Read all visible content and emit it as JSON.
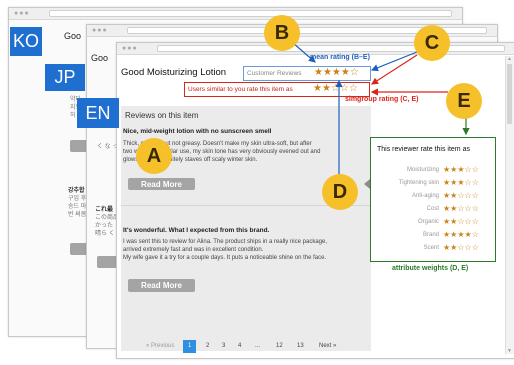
{
  "windows": {
    "ko": {
      "lang": "KO",
      "title": "Goo",
      "side_lines": [
        "약다",
        "지도",
        "허"
      ],
      "side2_lines": [
        "강추합",
        "구입 후",
        "송드 마",
        "번 써봄"
      ]
    },
    "jp": {
      "lang": "JP",
      "title": "Goo",
      "side_lines": [
        "く な っ"
      ],
      "side2_lines": [
        "これ最",
        "この商品",
        "かった",
        "晴ら く"
      ]
    },
    "en": {
      "lang": "EN"
    }
  },
  "main": {
    "product_title": "Good Moisturizing Lotion",
    "customer_reviews_label": "Customer Reviews",
    "customer_reviews_stars": "★★★★☆",
    "similar_users_label": "Users similar to you rate this item as",
    "similar_users_stars": "★★☆☆☆",
    "reviews_heading": "Reviews on this item",
    "reviews": [
      {
        "title": "Nice, mid-weight lotion with no sunscreen smell",
        "body": [
          "Thick, creamy but not greasy. Doesn't make my skin ultra-soft, but after",
          "two weeks of regular use, my skin tone has very obviously evened out and",
          "glows. It also definitely staves off scaly winter skin."
        ],
        "button": "Read More"
      },
      {
        "title": "It's wonderful. What I expected from this brand.",
        "body": [
          "I was sent this to review for Alina. The product ships in a really nice package,",
          "arrived extremely fast and was in excellent condition.",
          "My wife gave it a try for a couple days. It puts a noticeable shine on the face."
        ],
        "button": "Read More"
      }
    ],
    "pagination": {
      "prev": "« Previous",
      "pages": [
        "1",
        "2",
        "3",
        "4",
        "...",
        "12",
        "13"
      ],
      "current": "1",
      "next": "Next »"
    }
  },
  "reviewer_box": {
    "title": "This reviewer rate this item as",
    "attributes": [
      {
        "name": "Moisturizing",
        "stars": "★★★☆☆"
      },
      {
        "name": "Tightening skin",
        "stars": "★★★☆☆"
      },
      {
        "name": "Anti-aging",
        "stars": "★★☆☆☆"
      },
      {
        "name": "Cost",
        "stars": "★★☆☆☆"
      },
      {
        "name": "Organic",
        "stars": "★★☆☆☆"
      },
      {
        "name": "Brand",
        "stars": "★★★★☆"
      },
      {
        "name": "Scent",
        "stars": "★★☆☆☆"
      }
    ]
  },
  "annotations": {
    "A": "A",
    "B": "B",
    "C": "C",
    "D": "D",
    "E": "E",
    "mean_rating": "mean rating (B–E)",
    "simgroup_rating": "simgroup rating (C, E)",
    "attribute_weights": "attribute weights (D, E)"
  },
  "colors": {
    "lang_blue": "#1f6fd0",
    "marker_yellow": "#f5c02a",
    "blue": "#1f5fbf",
    "red": "#d9261c",
    "green": "#2c7a2c",
    "star": "#c8841a"
  }
}
